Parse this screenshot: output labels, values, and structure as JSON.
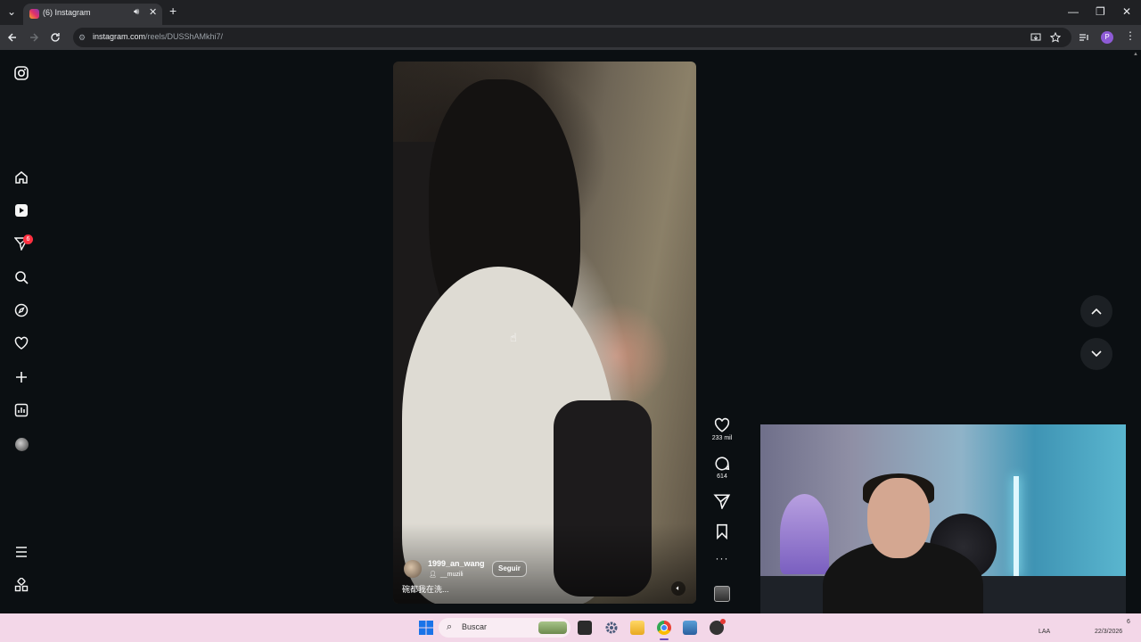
{
  "browser": {
    "tab_title": "(6) Instagram",
    "tab_close": "✕",
    "new_tab": "+",
    "url_host": "instagram.com",
    "url_path": "/reels/DUSShAMkhi7/",
    "window_controls": {
      "minimize": "—",
      "maximize": "❐",
      "close": "✕"
    },
    "profile_initial": "P"
  },
  "sidebar": {
    "notifications_badge": "6",
    "icons": [
      "instagram-icon",
      "home-icon",
      "reels-icon",
      "messages-icon",
      "search-icon",
      "explore-icon",
      "notifications-icon",
      "create-icon",
      "dashboard-icon",
      "profile-icon",
      "menu-icon",
      "meta-apps-icon"
    ]
  },
  "reel": {
    "username": "1999_an_wang",
    "audio_label": "__muzili",
    "follow_label": "Seguir",
    "caption": "碗都我在洗..."
  },
  "actions": {
    "likes": "233 mil",
    "comments": "614"
  },
  "taskbar": {
    "search_placeholder": "Buscar",
    "lang": "LAA",
    "date": "22/3/2026",
    "time_partial": "6"
  },
  "colors": {
    "page_bg": "#0b0f12",
    "badge": "#ff3040",
    "taskbar": "#f3d7e8"
  }
}
